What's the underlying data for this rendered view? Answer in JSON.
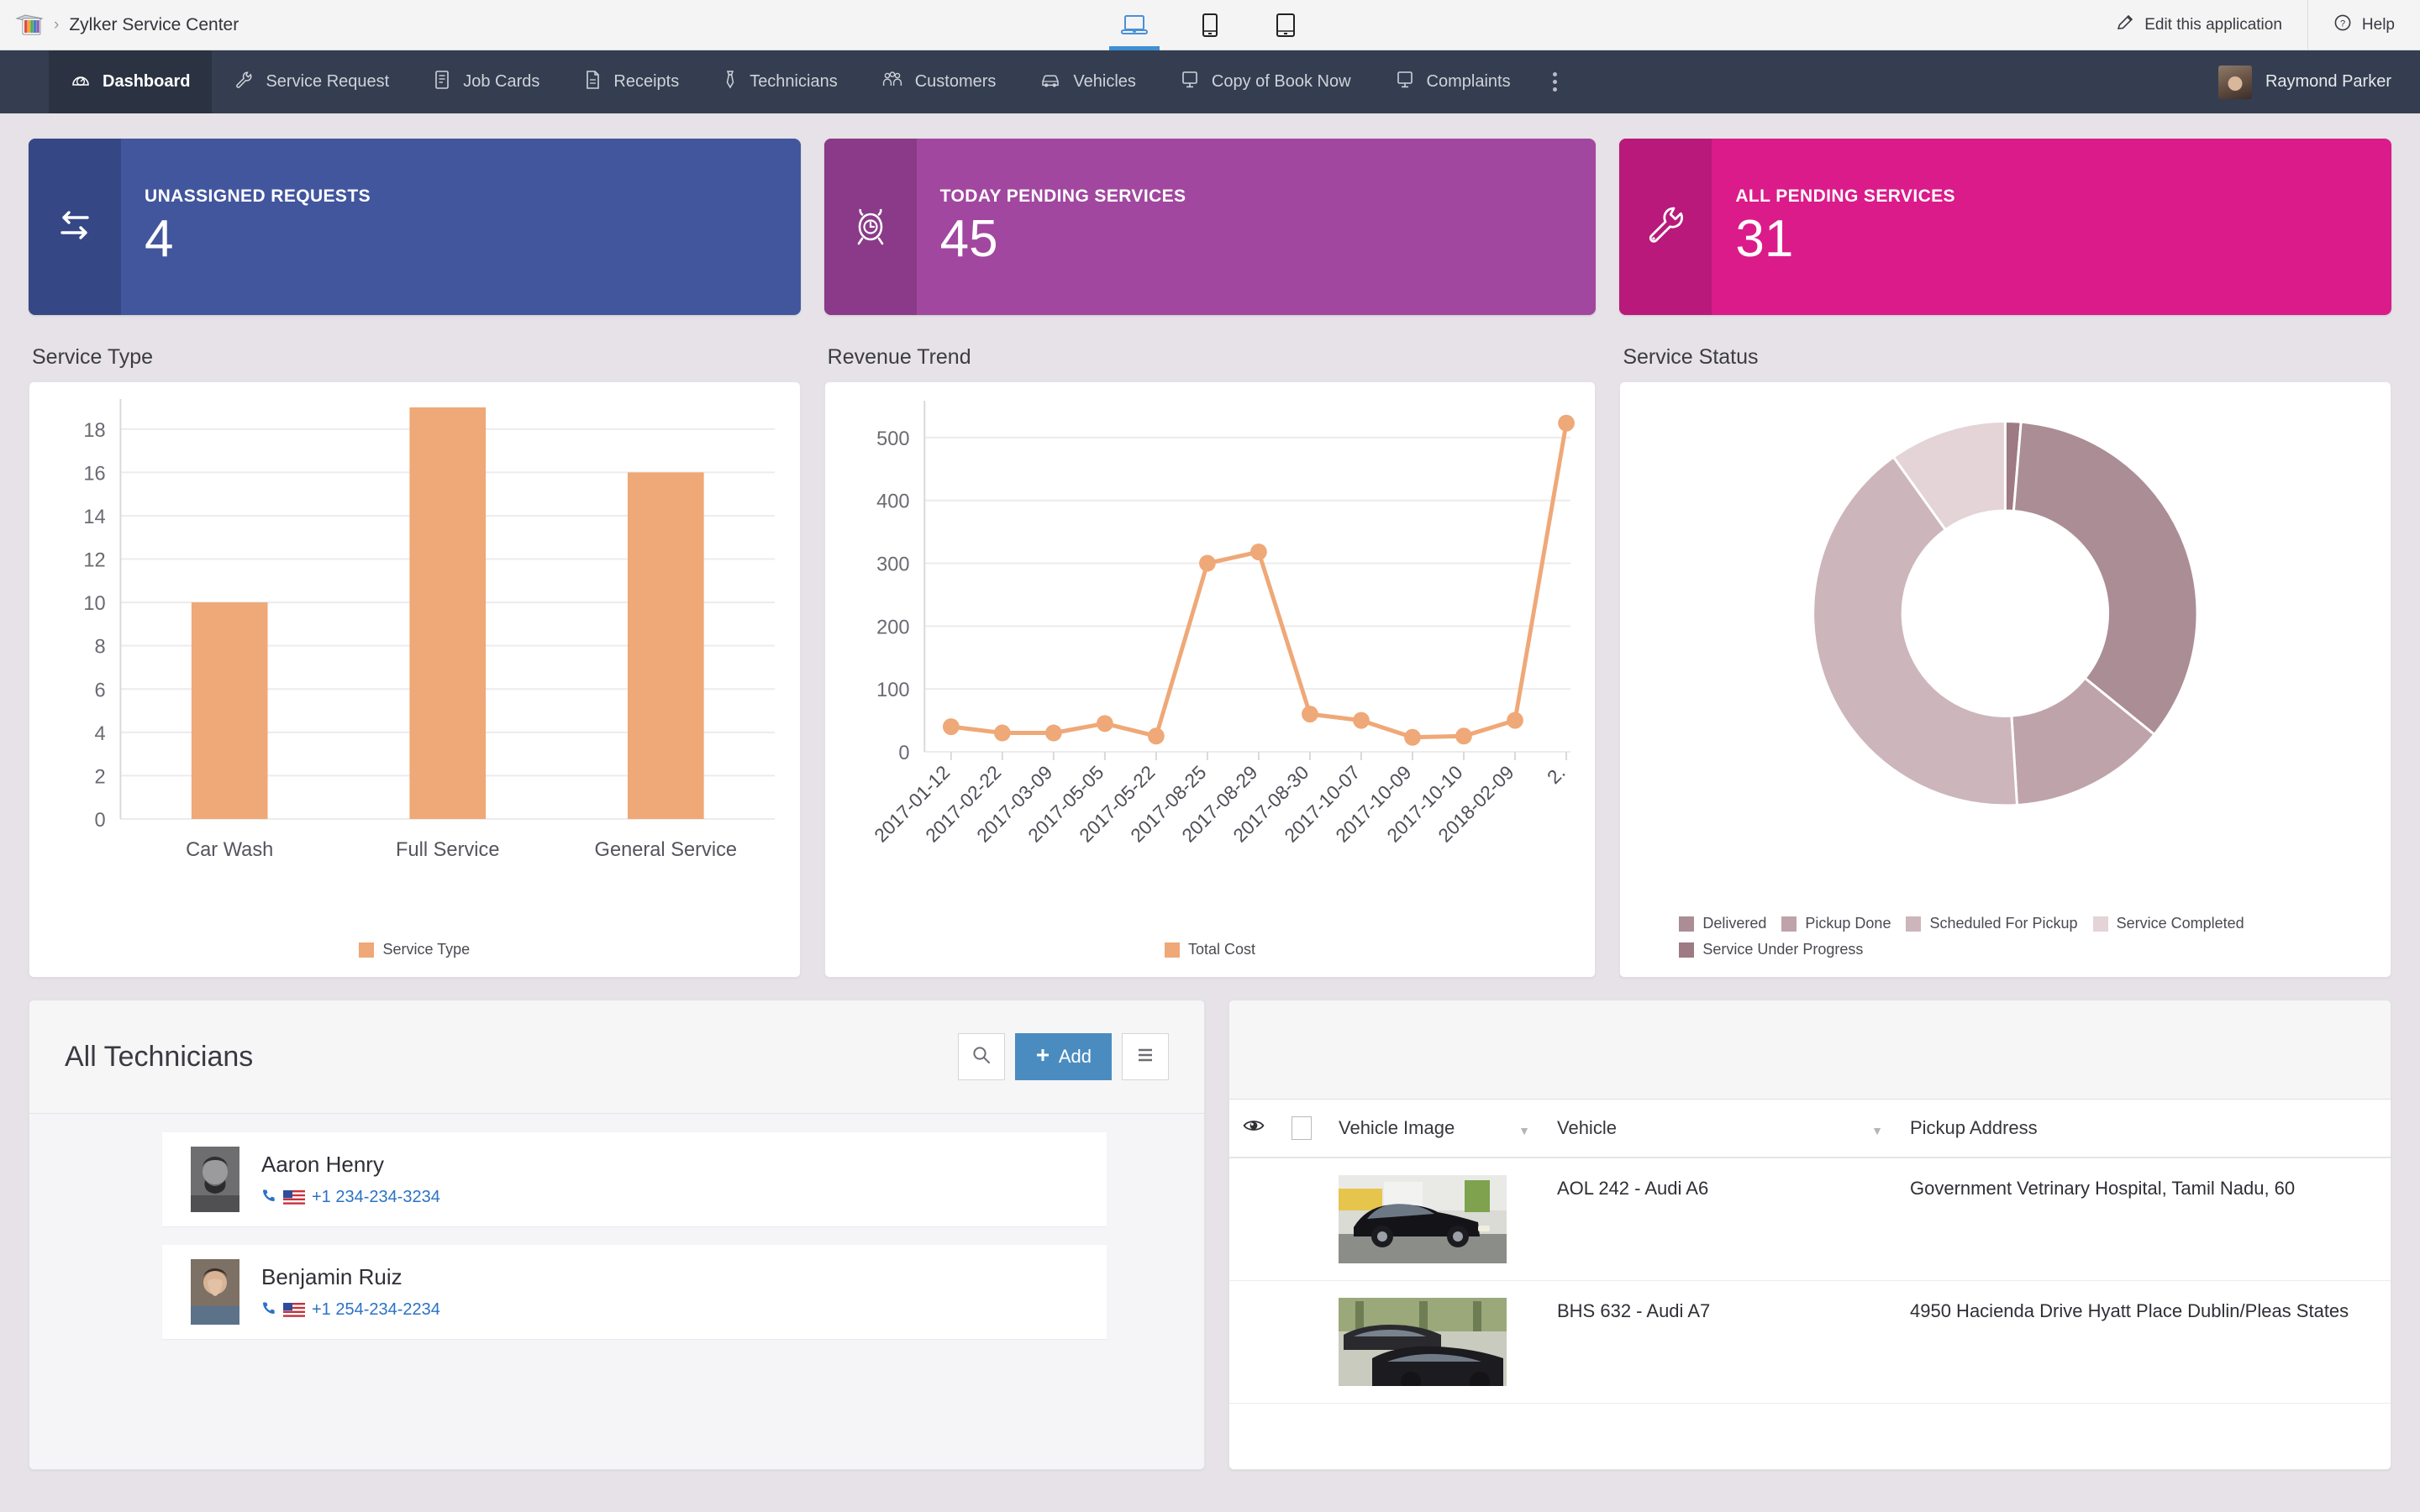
{
  "topbar": {
    "breadcrumb_separator": "›",
    "app_title": "Zylker Service Center",
    "devices": [
      {
        "name": "desktop-view",
        "active": true
      },
      {
        "name": "mobile-view",
        "active": false
      },
      {
        "name": "tablet-view",
        "active": false
      }
    ],
    "edit_label": "Edit this application",
    "help_label": "Help"
  },
  "nav": {
    "items": [
      {
        "label": "Dashboard",
        "icon": "gauge-icon",
        "active": true
      },
      {
        "label": "Service Request",
        "icon": "wrench-icon",
        "active": false
      },
      {
        "label": "Job Cards",
        "icon": "clipboard-icon",
        "active": false
      },
      {
        "label": "Receipts",
        "icon": "document-icon",
        "active": false
      },
      {
        "label": "Technicians",
        "icon": "tie-icon",
        "active": false
      },
      {
        "label": "Customers",
        "icon": "people-icon",
        "active": false
      },
      {
        "label": "Vehicles",
        "icon": "car-icon",
        "active": false
      },
      {
        "label": "Copy of Book Now",
        "icon": "monitor-icon",
        "active": false
      },
      {
        "label": "Complaints",
        "icon": "monitor-icon",
        "active": false
      }
    ],
    "more_icon": "kebab-menu-icon",
    "user_name": "Raymond Parker"
  },
  "kpis": [
    {
      "label": "UNASSIGNED REQUESTS",
      "value": "4",
      "icon": "exchange-arrows-icon",
      "bg": "#42569e",
      "icon_bg": "#354785"
    },
    {
      "label": "TODAY PENDING SERVICES",
      "value": "45",
      "icon": "alarm-clock-icon",
      "bg": "#a1479f",
      "icon_bg": "#8a3a88"
    },
    {
      "label": "ALL PENDING SERVICES",
      "value": "31",
      "icon": "wrench-icon",
      "bg": "#db1b8a",
      "icon_bg": "#b8197b"
    }
  ],
  "charts": {
    "service_type_title": "Service Type",
    "revenue_trend_title": "Revenue Trend",
    "service_status_title": "Service Status"
  },
  "chart_data": [
    {
      "type": "bar",
      "title": "Service Type",
      "categories": [
        "Car Wash",
        "Full Service",
        "General Service"
      ],
      "values": [
        10,
        19,
        16
      ],
      "series_name": "Service Type",
      "color": "#efa877",
      "xlabel": "",
      "ylabel": "",
      "ylim": [
        0,
        19
      ],
      "yticks": [
        0,
        2,
        4,
        6,
        8,
        10,
        12,
        14,
        16,
        18
      ],
      "grid": true,
      "legend": [
        "Service Type"
      ],
      "legend_position": "bottom-center"
    },
    {
      "type": "line",
      "title": "Revenue Trend",
      "x": [
        "2017-01-12",
        "2017-02-22",
        "2017-03-09",
        "2017-05-05",
        "2017-05-22",
        "2017-08-25",
        "2017-08-29",
        "2017-08-30",
        "2017-10-07",
        "2017-10-09",
        "2017-10-10",
        "2018-02-09",
        "2."
      ],
      "values": [
        40,
        30,
        30,
        45,
        25,
        300,
        318,
        60,
        50,
        23,
        25,
        50,
        523
      ],
      "series_name": "Total Cost",
      "color": "#efa877",
      "xlabel": "",
      "ylabel": "",
      "ylim": [
        0,
        540
      ],
      "yticks": [
        0,
        100,
        200,
        300,
        400,
        500
      ],
      "grid": true,
      "markers": true,
      "legend": [
        "Total Cost"
      ],
      "legend_position": "bottom-center"
    },
    {
      "type": "pie",
      "subtype": "donut",
      "title": "Service Status",
      "labels": [
        "Delivered",
        "Pickup Done",
        "Scheduled For Pickup",
        "Service Completed",
        "Service Under Progress"
      ],
      "values": [
        4,
        105,
        40,
        125,
        30
      ],
      "colors": [
        "#9d7a84",
        "#ab8d95",
        "#bfa3aa",
        "#ccb5bb",
        "#e4d3d7"
      ],
      "slice_colors_by_label": {
        "Delivered": "#ab8d95",
        "Pickup Done": "#bfa3aa",
        "Scheduled For Pickup": "#ccb5bb",
        "Service Completed": "#e4d3d7",
        "Service Under Progress": "#9d7a84"
      },
      "legend": [
        "Delivered",
        "Pickup Done",
        "Scheduled For Pickup",
        "Service Completed",
        "Service Under Progress"
      ],
      "legend_position": "bottom-left"
    }
  ],
  "technicians_panel": {
    "title": "All Technicians",
    "search_icon": "search-icon",
    "add_label": "Add",
    "menu_icon": "hamburger-icon",
    "items": [
      {
        "name": "Aaron Henry",
        "phone": "+1 234-234-3234",
        "country": "US"
      },
      {
        "name": "Benjamin Ruiz",
        "phone": "+1 254-234-2234",
        "country": "US"
      }
    ]
  },
  "vehicles_table": {
    "columns": [
      "Vehicle Image",
      "Vehicle",
      "Pickup Address"
    ],
    "eye_icon": "eye-icon",
    "select_all": "",
    "rows": [
      {
        "vehicle": "AOL 242 - Audi A6",
        "address": "Government Vetrinary Hospital, Tamil Nadu, 60",
        "image": "black-audi-a6-photo"
      },
      {
        "vehicle": "BHS 632 - Audi A7",
        "address": "4950 Hacienda Drive Hyatt Place Dublin/Pleas States",
        "image": "dark-audi-a7-photo"
      }
    ]
  }
}
